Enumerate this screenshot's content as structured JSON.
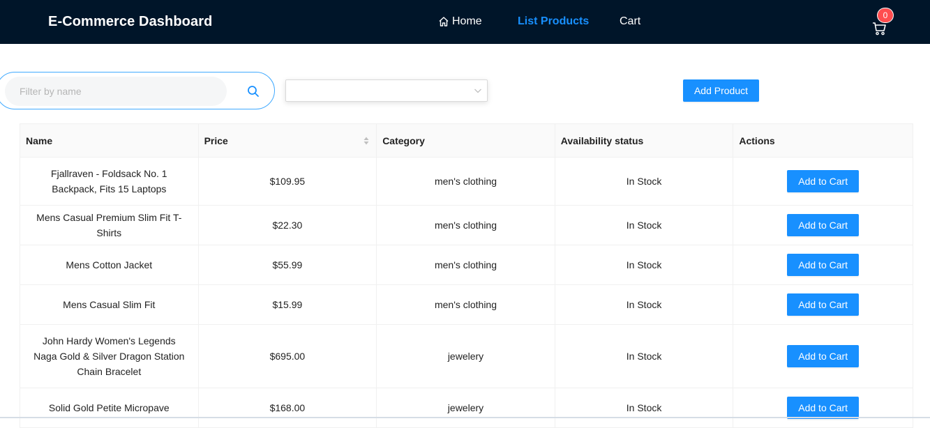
{
  "header": {
    "brand": "E-Commerce Dashboard",
    "nav": [
      {
        "label": "Home",
        "icon": "home-icon"
      },
      {
        "label": "List Products",
        "active": true
      },
      {
        "label": "Cart"
      }
    ],
    "cart_count": "0",
    "cart_icon": "shopping-cart-icon",
    "colors": {
      "bar": "#001529",
      "accent": "#1890ff",
      "badge": "#ff4d4f"
    }
  },
  "toolbar": {
    "search_placeholder": "Filter by name",
    "search_value": "",
    "category_selected": "",
    "add_product_label": "Add Product"
  },
  "table": {
    "columns": [
      "Name",
      "Price",
      "Category",
      "Availability status",
      "Actions"
    ],
    "action_label": "Add to Cart",
    "rows": [
      {
        "name": "Fjallraven - Foldsack No. 1 Backpack, Fits 15 Laptops",
        "price": "$109.95",
        "category": "men's clothing",
        "status": "In Stock"
      },
      {
        "name": "Mens Casual Premium Slim Fit T-Shirts",
        "price": "$22.30",
        "category": "men's clothing",
        "status": "In Stock"
      },
      {
        "name": "Mens Cotton Jacket",
        "price": "$55.99",
        "category": "men's clothing",
        "status": "In Stock"
      },
      {
        "name": "Mens Casual Slim Fit",
        "price": "$15.99",
        "category": "men's clothing",
        "status": "In Stock"
      },
      {
        "name": "John Hardy Women's Legends Naga Gold & Silver Dragon Station Chain Bracelet",
        "price": "$695.00",
        "category": "jewelery",
        "status": "In Stock"
      },
      {
        "name": "Solid Gold Petite Micropave",
        "price": "$168.00",
        "category": "jewelery",
        "status": "In Stock"
      }
    ]
  }
}
